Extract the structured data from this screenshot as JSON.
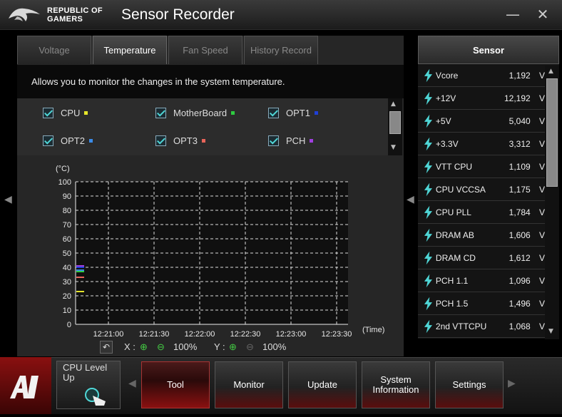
{
  "titlebar": {
    "brand": "REPUBLIC OF\nGAMERS",
    "title": "Sensor Recorder",
    "minimize": "—",
    "close": "✕"
  },
  "tabs": [
    {
      "label": "Voltage",
      "active": false
    },
    {
      "label": "Temperature",
      "active": true
    },
    {
      "label": "Fan Speed",
      "active": false
    },
    {
      "label": "History Record",
      "active": false
    }
  ],
  "description": "Allows you to monitor the changes in the system temperature.",
  "checkboxes": [
    {
      "label": "CPU",
      "color": "#e6e62a",
      "checked": true
    },
    {
      "label": "MotherBoard",
      "color": "#2ecc40",
      "checked": true
    },
    {
      "label": "OPT1",
      "color": "#1f3fd6",
      "checked": true
    },
    {
      "label": "OPT2",
      "color": "#3b8be8",
      "checked": true
    },
    {
      "label": "OPT3",
      "color": "#e8645a",
      "checked": true
    },
    {
      "label": "PCH",
      "color": "#a040e0",
      "checked": true
    }
  ],
  "chart_data": {
    "type": "line",
    "ylabel": "(°C)",
    "xlabel": "(Time)",
    "ylim": [
      0,
      100
    ],
    "y_ticks": [
      "0",
      "10",
      "20",
      "30",
      "40",
      "50",
      "60",
      "70",
      "80",
      "90",
      "100"
    ],
    "x_ticks": [
      "12:21:00",
      "12:21:30",
      "12:22:00",
      "12:22:30",
      "12:23:00",
      "12:23:30"
    ],
    "grid": true,
    "series": [
      {
        "name": "CPU",
        "color": "#e6e62a",
        "values": [
          23
        ]
      },
      {
        "name": "MotherBoard",
        "color": "#2ecc40",
        "values": [
          37
        ]
      },
      {
        "name": "OPT1",
        "color": "#1f3fd6",
        "values": [
          40
        ]
      },
      {
        "name": "OPT2",
        "color": "#3b8be8",
        "values": [
          38
        ]
      },
      {
        "name": "OPT3",
        "color": "#e8645a",
        "values": [
          33
        ]
      },
      {
        "name": "PCH",
        "color": "#a040e0",
        "values": [
          41
        ]
      }
    ]
  },
  "zoom": {
    "x_label": "X :",
    "x_value": "100%",
    "y_label": "Y :",
    "y_value": "100%"
  },
  "sensor": {
    "header": "Sensor",
    "rows": [
      {
        "name": "Vcore",
        "value": "1,192",
        "unit": "V"
      },
      {
        "name": "+12V",
        "value": "12,192",
        "unit": "V"
      },
      {
        "name": "+5V",
        "value": "5,040",
        "unit": "V"
      },
      {
        "name": "+3.3V",
        "value": "3,312",
        "unit": "V"
      },
      {
        "name": "VTT CPU",
        "value": "1,109",
        "unit": "V"
      },
      {
        "name": "CPU VCCSA",
        "value": "1,175",
        "unit": "V"
      },
      {
        "name": "CPU PLL",
        "value": "1,784",
        "unit": "V"
      },
      {
        "name": "DRAM AB",
        "value": "1,606",
        "unit": "V"
      },
      {
        "name": "DRAM CD",
        "value": "1,612",
        "unit": "V"
      },
      {
        "name": "PCH 1.1",
        "value": "1,096",
        "unit": "V"
      },
      {
        "name": "PCH 1.5",
        "value": "1,496",
        "unit": "V"
      },
      {
        "name": "2nd VTTCPU",
        "value": "1,068",
        "unit": "V"
      }
    ]
  },
  "bottom": {
    "cpu_level": "CPU Level Up",
    "nav": [
      {
        "label": "Tool",
        "active": true
      },
      {
        "label": "Monitor",
        "active": false
      },
      {
        "label": "Update",
        "active": false
      },
      {
        "label": "System Information",
        "active": false
      },
      {
        "label": "Settings",
        "active": false
      }
    ]
  }
}
